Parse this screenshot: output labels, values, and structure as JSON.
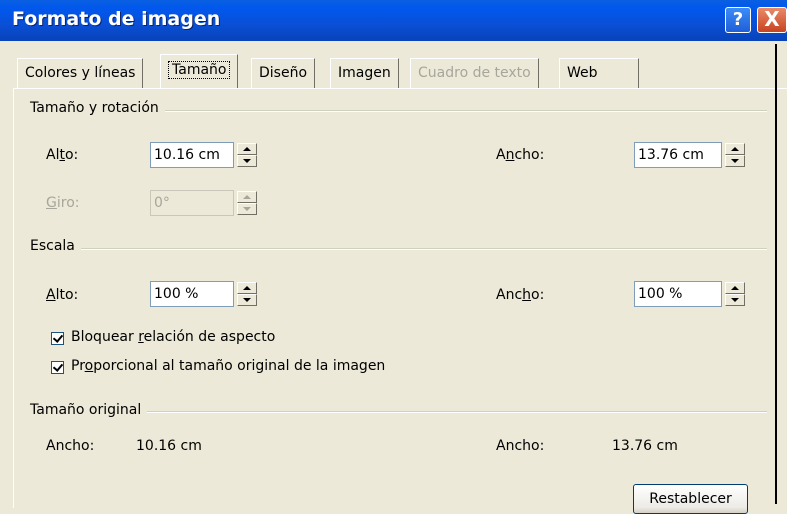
{
  "window": {
    "title": "Formato de imagen",
    "help_label": "?",
    "close_label": "X"
  },
  "tabs": [
    {
      "label": "Colores y líneas",
      "state": "normal"
    },
    {
      "label": "Tamaño",
      "state": "active"
    },
    {
      "label": "Diseño",
      "state": "normal"
    },
    {
      "label": "Imagen",
      "state": "normal"
    },
    {
      "label": "Cuadro de texto",
      "state": "disabled"
    },
    {
      "label": "Web",
      "state": "normal"
    }
  ],
  "size_rotation": {
    "title": "Tamaño y rotación",
    "height_label_pre": "Al",
    "height_label_u": "t",
    "height_label_post": "o:",
    "height_value": "10.16 cm",
    "width_label_pre": "A",
    "width_label_u": "n",
    "width_label_post": "cho:",
    "width_value": "13.76 cm",
    "rotation_label_pre": "",
    "rotation_label_u": "G",
    "rotation_label_post": "iro:",
    "rotation_value": "0°"
  },
  "scale": {
    "title": "Escala",
    "height_label_pre": "",
    "height_label_u": "A",
    "height_label_post": "lto:",
    "height_value": "100 %",
    "width_label_pre": "Anc",
    "width_label_u": "h",
    "width_label_post": "o:",
    "width_value": "100 %",
    "lock_aspect_pre": "Bloquear ",
    "lock_aspect_u": "r",
    "lock_aspect_post": "elación de aspecto",
    "lock_aspect_checked": true,
    "relative_original_pre": "Pr",
    "relative_original_u": "o",
    "relative_original_post": "porcional al tamaño original de la imagen",
    "relative_original_checked": true
  },
  "original_size": {
    "title": "Tamaño original",
    "height_label": "Ancho:",
    "height_value": "10.16 cm",
    "width_label": "Ancho:",
    "width_value": "13.76 cm"
  },
  "reset_button": "Restablecer"
}
